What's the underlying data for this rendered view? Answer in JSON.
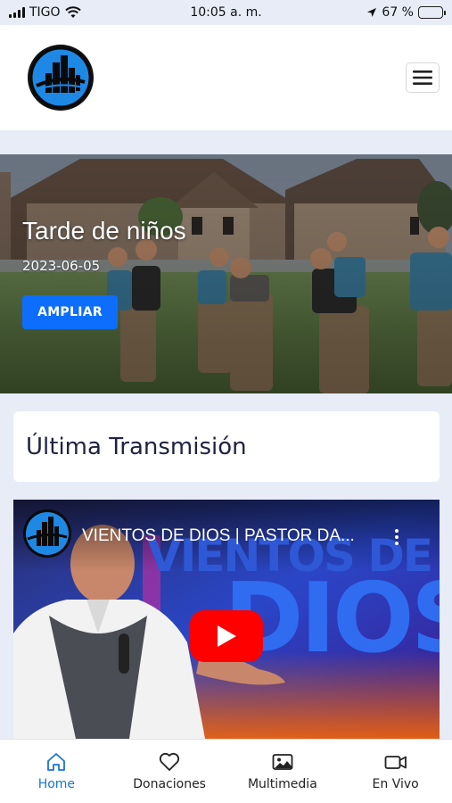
{
  "status_bar": {
    "carrier": "TIGO",
    "time": "10:05 a. m.",
    "battery_text": "67 %",
    "battery_level": 0.67
  },
  "header": {
    "logo_icon": "church-logo-icon",
    "menu_icon": "hamburger-menu-icon"
  },
  "hero": {
    "title": "Tarde de niños",
    "date": "2023-06-05",
    "button_label": "AMPLIAR"
  },
  "section": {
    "title": "Última Transmisión"
  },
  "video": {
    "title": "VIENTOS DE DIOS | PASTOR DA...",
    "thumbnail_line1": "VIENTOS DE",
    "thumbnail_line2": "DIOS"
  },
  "bottom_nav": {
    "items": [
      {
        "label": "Home",
        "icon": "home-icon",
        "active": true
      },
      {
        "label": "Donaciones",
        "icon": "heart-icon",
        "active": false
      },
      {
        "label": "Multimedia",
        "icon": "image-icon",
        "active": false
      },
      {
        "label": "En Vivo",
        "icon": "video-camera-icon",
        "active": false
      }
    ]
  },
  "colors": {
    "accent": "#0d6efd",
    "active_nav": "#1976d2",
    "page_bg": "#e7ecf7"
  }
}
